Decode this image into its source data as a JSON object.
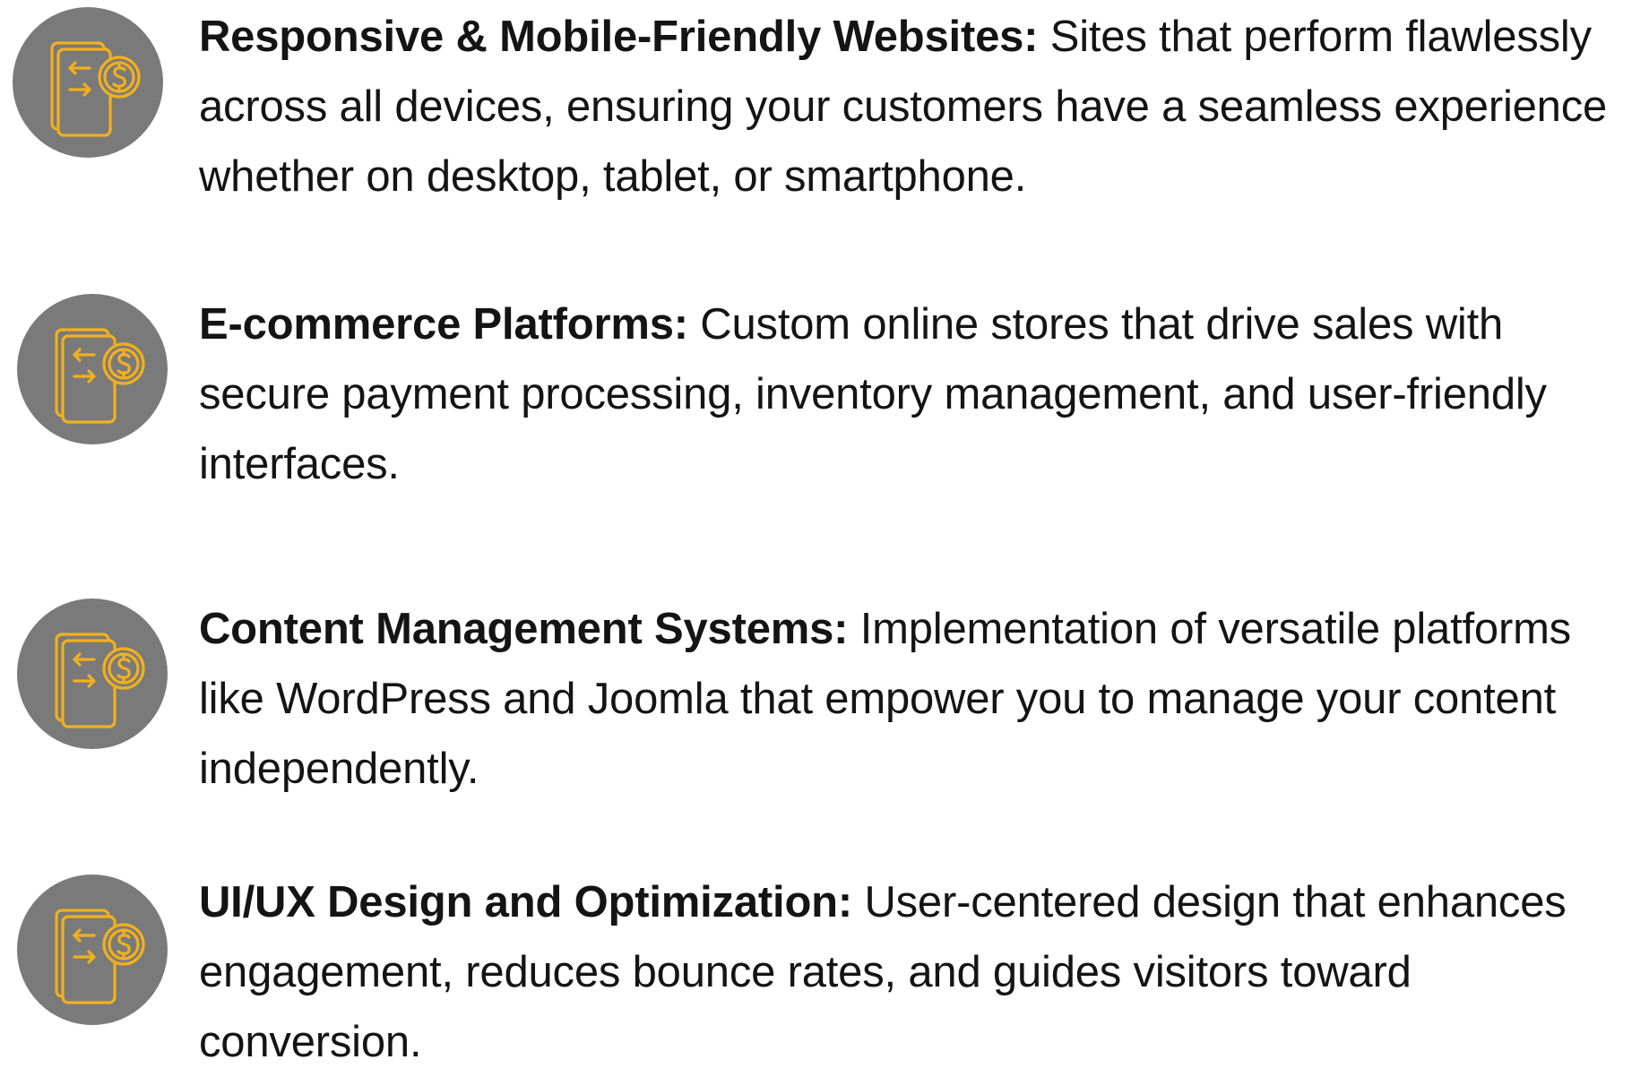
{
  "colors": {
    "badge_background": "#7a7a7a",
    "icon_stroke": "#f2b01e",
    "text": "#141414"
  },
  "icon": "phone-dollar-exchange-icon",
  "features": [
    {
      "lead": "Responsive & Mobile-Friendly Websites:",
      "body": " Sites that perform flawlessly across all devices, ensuring your customers have a seamless experience whether on desktop, tablet, or smartphone."
    },
    {
      "lead": "E-commerce Platforms:",
      "body": " Custom online stores that drive sales with secure payment processing, inventory management, and user-friendly interfaces."
    },
    {
      "lead": "Content Management Systems:",
      "body": " Implementation of versatile platforms like WordPress and Joomla that empower you to manage your content independently."
    },
    {
      "lead": "UI/UX Design and Optimization:",
      "body": " User-centered design that enhances engagement, reduces bounce rates, and guides visitors toward conversion."
    }
  ]
}
